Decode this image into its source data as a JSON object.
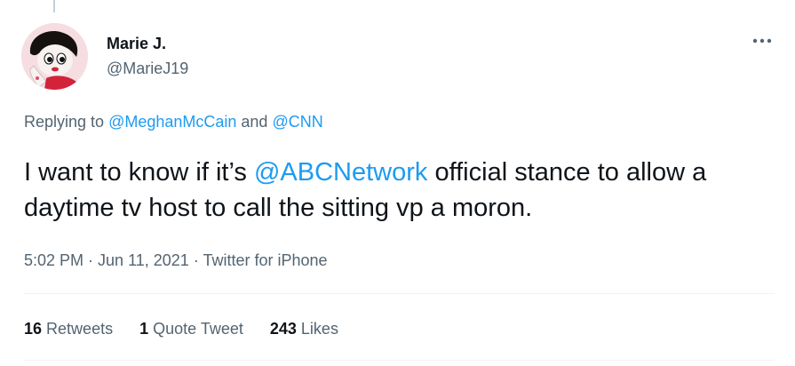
{
  "tweet": {
    "author": {
      "display_name": "Marie J.",
      "handle": "@MarieJ19",
      "avatar_icon": "cartoon-avatar-image"
    },
    "more_icon": "ellipsis-icon",
    "replying": {
      "prefix": "Replying to ",
      "mention_1": "@MeghanMcCain",
      "joiner": " and ",
      "mention_2": "@CNN"
    },
    "text": {
      "part_1": "I want to know if it’s ",
      "mention": "@ABCNetwork",
      "part_2": " official stance to allow a daytime tv host to call the sitting vp a moron."
    },
    "meta": {
      "time": "5:02 PM",
      "separator": " · ",
      "date": "Jun 11, 2021",
      "source": "Twitter for iPhone"
    },
    "stats": [
      {
        "count": "16",
        "label": "Retweets"
      },
      {
        "count": "1",
        "label": "Quote Tweet"
      },
      {
        "count": "243",
        "label": "Likes"
      }
    ]
  },
  "colors": {
    "text_primary": "#0f1419",
    "text_secondary": "#536471",
    "accent": "#1d9bf0",
    "divider": "#eff3f4"
  }
}
